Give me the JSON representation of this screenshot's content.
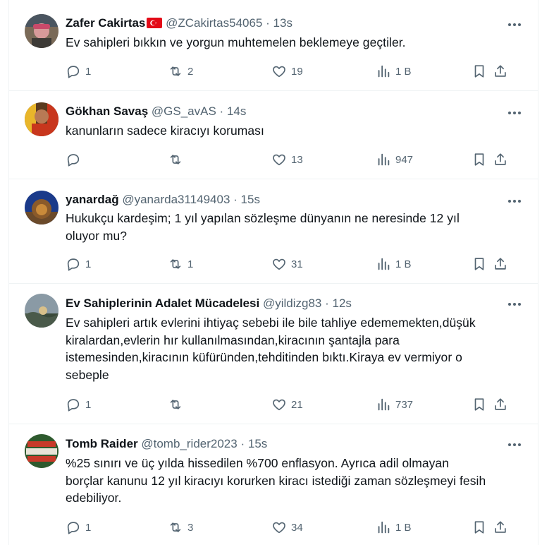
{
  "tweets": [
    {
      "name": "Zafer Cakirtas",
      "flag": "turkey-flag-icon",
      "handle": "@ZCakirtas54065",
      "dot": "·",
      "time": "13s",
      "lines": [
        "Ev sahipleri bıkkın ve yorgun muhtemelen beklemeye geçtiler."
      ],
      "replies": "1",
      "retweets": "2",
      "likes": "19",
      "views": "1 B",
      "avatar_colors": [
        "#7a6a58",
        "#d89a9a",
        "#3d3a36"
      ]
    },
    {
      "name": "Gökhan Savaş",
      "handle": "@GS_avAS",
      "dot": "·",
      "time": "14s",
      "lines": [
        "kanunların sadece kiracıyı koruması"
      ],
      "replies": "",
      "retweets": "",
      "likes": "13",
      "views": "947",
      "avatar_colors": [
        "#c8361d",
        "#e9b62a",
        "#5a3a1e"
      ]
    },
    {
      "name": "yanardağ",
      "handle": "@yanarda31149403",
      "dot": "·",
      "time": "15s",
      "lines": [
        "Hukukçu kardeşim; 1 yıl yapılan sözleşme dünyanın ne neresinde 12 yıl",
        "oluyor mu?"
      ],
      "replies": "1",
      "retweets": "1",
      "likes": "31",
      "views": "1 B",
      "avatar_colors": [
        "#1a3a8a",
        "#c98a3a",
        "#6b4a2a"
      ]
    },
    {
      "name": "Ev Sahiplerinin Adalet Mücadelesi",
      "handle": "@yildizg83",
      "dot": "·",
      "time": "12s",
      "lines": [
        "Ev sahipleri artık evlerini ihtiyaç sebebi ile bile tahliye edememekten,düşük",
        "kiralardan,evlerin hır kullanılmasından,kiracının şantajla para",
        "istemesinden,kiracının küfüründen,tehditinden bıktı.Kiraya ev vermiyor o",
        "sebeple"
      ],
      "replies": "1",
      "retweets": "",
      "likes": "21",
      "views": "737",
      "avatar_colors": [
        "#8a9aa5",
        "#d8c08a",
        "#3a4a3a"
      ]
    },
    {
      "name": "Tomb Raider",
      "handle": "@tomb_rider2023",
      "dot": "·",
      "time": "15s",
      "lines": [
        "%25 sınırı ve üç yılda hissedilen %700 enflasyon. Ayrıca adil olmayan",
        "borçlar kanunu 12 yıl kiracıyı korurken kiracı istediği zaman sözleşmeyi fesih",
        "edebiliyor."
      ],
      "replies": "1",
      "retweets": "3",
      "likes": "34",
      "views": "1 B",
      "avatar_colors": [
        "#2e5a2e",
        "#c83a2a",
        "#e8e4d8"
      ]
    }
  ]
}
